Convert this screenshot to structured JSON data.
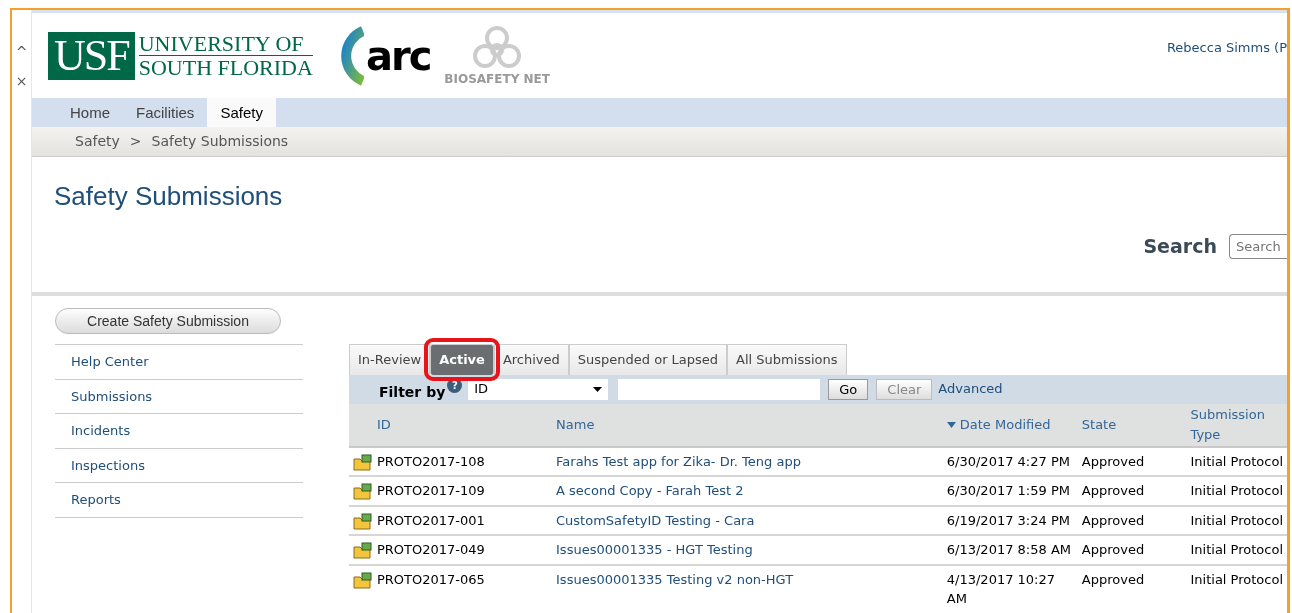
{
  "side_controls": [
    "^",
    "×"
  ],
  "logos": {
    "usf_mark": "USF",
    "usf_line1": "UNIVERSITY OF",
    "usf_line2": "SOUTH FLORIDA",
    "arc": "arc",
    "biosafety": "BIOSAFETY NET"
  },
  "user": "Rebecca Simms (P",
  "nav_tabs": [
    {
      "label": "Home",
      "selected": false
    },
    {
      "label": "Facilities",
      "selected": false
    },
    {
      "label": "Safety",
      "selected": true
    }
  ],
  "breadcrumb": [
    "Safety",
    ">",
    "Safety Submissions"
  ],
  "page_title": "Safety Submissions",
  "search": {
    "label": "Search",
    "placeholder": "Search"
  },
  "create_button": "Create Safety Submission",
  "sidebar": {
    "items": [
      {
        "label": "Help Center"
      },
      {
        "label": "Submissions"
      },
      {
        "label": "Incidents"
      },
      {
        "label": "Inspections"
      },
      {
        "label": "Reports"
      }
    ]
  },
  "tabs": [
    {
      "label": "In-Review",
      "selected": false,
      "highlighted": false
    },
    {
      "label": "Active",
      "selected": true,
      "highlighted": true
    },
    {
      "label": "Archived",
      "selected": false,
      "highlighted": false
    },
    {
      "label": "Suspended or Lapsed",
      "selected": false,
      "highlighted": false
    },
    {
      "label": "All Submissions",
      "selected": false,
      "highlighted": false
    }
  ],
  "filter": {
    "label": "Filter by",
    "help": "?",
    "field": "ID",
    "go": "Go",
    "clear": "Clear",
    "advanced": "Advanced"
  },
  "table": {
    "columns": [
      {
        "label": "ID",
        "sorted": false
      },
      {
        "label": "Name",
        "sorted": false
      },
      {
        "label": "Date Modified",
        "sorted": true
      },
      {
        "label": "State",
        "sorted": false
      },
      {
        "label": "Submission Type",
        "sorted": false
      }
    ],
    "rows": [
      {
        "id": "PROTO2017-108",
        "name": "Farahs Test app for Zika- Dr. Teng app",
        "date": "6/30/2017 4:27 PM",
        "state": "Approved",
        "type": "Initial Protocol"
      },
      {
        "id": "PROTO2017-109",
        "name": "A second Copy - Farah Test 2",
        "date": "6/30/2017 1:59 PM",
        "state": "Approved",
        "type": "Initial Protocol"
      },
      {
        "id": "PROTO2017-001",
        "name": "CustomSafetyID Testing - Cara",
        "date": "6/19/2017 3:24 PM",
        "state": "Approved",
        "type": "Initial Protocol"
      },
      {
        "id": "PROTO2017-049",
        "name": "Issues00001335 - HGT Testing",
        "date": "6/13/2017 8:58 AM",
        "state": "Approved",
        "type": "Initial Protocol"
      },
      {
        "id": "PROTO2017-065",
        "name": "Issues00001335 Testing v2 non-HGT",
        "date": "4/13/2017 10:27 AM",
        "state": "Approved",
        "type": "Initial Protocol"
      }
    ]
  }
}
